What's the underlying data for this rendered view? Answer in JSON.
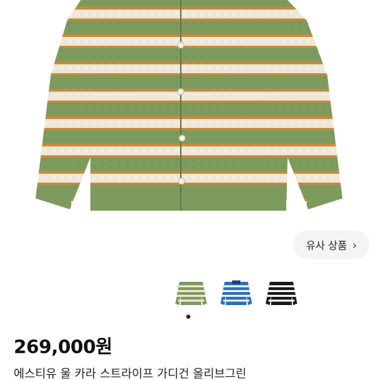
{
  "product": {
    "similar_button_label": "유사 상품",
    "price": "269,000원",
    "title": "에스티유 울 카라 스트라이프 가디건 올리브그린"
  },
  "gallery": {
    "variants": [
      {
        "name": "olive-green",
        "main": "#7e9b5e",
        "stripe": "#eee6d6",
        "accent": "#c98a3b"
      },
      {
        "name": "blue",
        "main": "#2f6fb8",
        "stripe": "#e8eef5",
        "accent": "#1b3f7a"
      },
      {
        "name": "black",
        "main": "#1a1a1a",
        "stripe": "#f2f2f2",
        "accent": "#444444"
      }
    ],
    "selected_index": 0
  },
  "colors": {
    "sweater_green": "#7e9b5e",
    "sweater_cream": "#eee6d6",
    "sweater_orange": "#c98a3b",
    "button_bg": "#f3f4f6"
  },
  "icons": {
    "similar_chevron": "chevron-right-icon"
  }
}
